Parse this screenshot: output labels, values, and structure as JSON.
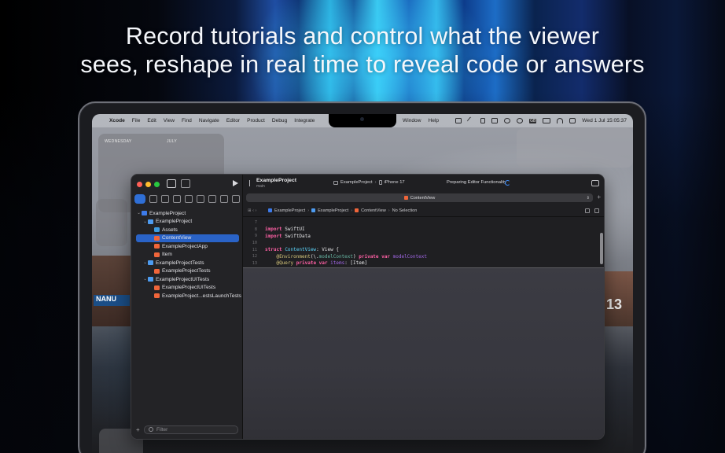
{
  "headline": {
    "line1": "Record tutorials and control what the viewer",
    "line2": "sees, reshape in real time to reveal code or answers"
  },
  "menubar": {
    "app_name": "Xcode",
    "menus": [
      "File",
      "Edit",
      "View",
      "Find",
      "Navigate",
      "Editor",
      "Product",
      "Debug",
      "Integrate"
    ],
    "right_menus": [
      "Window",
      "Help"
    ],
    "clock": "Wed 1 Jul  15:05:37",
    "status_icons": [
      "screen-icon",
      "tools-icon",
      "phone-icon",
      "display-icon",
      "record-icon",
      "stopwatch-icon",
      "gb-icon",
      "battery-icon",
      "wifi-icon",
      "control-center-icon"
    ],
    "gb_label": "GB"
  },
  "widgets": {
    "calendar_left_label": "WEDNESDAY",
    "calendar_right_label": "JULY"
  },
  "wallpaper": {
    "sign_text": "NANU",
    "building_number": "13"
  },
  "xcode": {
    "project_name": "ExampleProject",
    "branch": "main",
    "scheme": "ExampleProject",
    "destination": "iPhone 17",
    "activity": "Preparing Editor Functionality",
    "open_tab": "ContentView",
    "jumpbar": [
      "ExampleProject",
      "ExampleProject",
      "ContentView",
      "No Selection"
    ],
    "filter_placeholder": "Filter",
    "tree": [
      {
        "label": "ExampleProject",
        "icon": "project",
        "depth": 0,
        "chevron": "v"
      },
      {
        "label": "ExampleProject",
        "icon": "folder",
        "depth": 1,
        "chevron": "v"
      },
      {
        "label": "Assets",
        "icon": "assets",
        "depth": 2,
        "chevron": ""
      },
      {
        "label": "ContentView",
        "icon": "swift",
        "depth": 2,
        "chevron": "",
        "selected": true
      },
      {
        "label": "ExampleProjectApp",
        "icon": "swift",
        "depth": 2,
        "chevron": ""
      },
      {
        "label": "Item",
        "icon": "swift",
        "depth": 2,
        "chevron": ""
      },
      {
        "label": "ExampleProjectTests",
        "icon": "folder",
        "depth": 1,
        "chevron": "v"
      },
      {
        "label": "ExampleProjectTests",
        "icon": "swift",
        "depth": 2,
        "chevron": ""
      },
      {
        "label": "ExampleProjectUITests",
        "icon": "folder",
        "depth": 1,
        "chevron": "v"
      },
      {
        "label": "ExampleProjectUITests",
        "icon": "swift",
        "depth": 2,
        "chevron": ""
      },
      {
        "label": "ExampleProject...estsLaunchTests",
        "icon": "swift",
        "depth": 2,
        "chevron": ""
      }
    ],
    "code": [
      {
        "n": "7",
        "parts": []
      },
      {
        "n": "8",
        "parts": [
          [
            "kw",
            "import"
          ],
          [
            "pl",
            " SwiftUI"
          ]
        ]
      },
      {
        "n": "9",
        "parts": [
          [
            "kw",
            "import"
          ],
          [
            "pl",
            " SwiftData"
          ]
        ]
      },
      {
        "n": "10",
        "parts": []
      },
      {
        "n": "11",
        "parts": [
          [
            "kw",
            "struct"
          ],
          [
            "pl",
            " "
          ],
          [
            "ty",
            "ContentView"
          ],
          [
            "pl",
            ": View {"
          ]
        ]
      },
      {
        "n": "12",
        "parts": [
          [
            "pl",
            "    "
          ],
          [
            "at",
            "@Environment"
          ],
          [
            "pl",
            "(\\."
          ],
          [
            "kpath",
            "modelContext"
          ],
          [
            "pl",
            ") "
          ],
          [
            "kw",
            "private var"
          ],
          [
            "pl",
            " "
          ],
          [
            "pr",
            "modelContext"
          ]
        ]
      },
      {
        "n": "13",
        "parts": [
          [
            "pl",
            "    "
          ],
          [
            "at",
            "@Query"
          ],
          [
            "pl",
            " "
          ],
          [
            "kw",
            "private var"
          ],
          [
            "pl",
            " "
          ],
          [
            "pr",
            "items"
          ],
          [
            "pl",
            ": [Item]"
          ]
        ]
      }
    ]
  },
  "colors": {
    "accent": "#2a63c7",
    "swift_file": "#f0653a",
    "keyword": "#fc5fa3"
  }
}
